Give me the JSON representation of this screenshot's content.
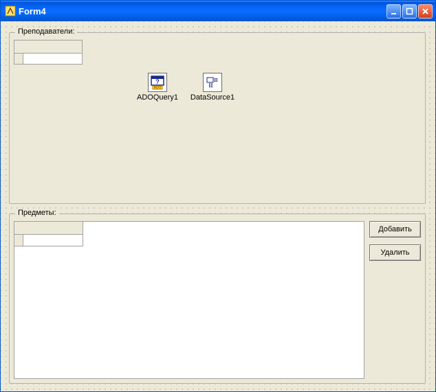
{
  "window": {
    "title": "Form4"
  },
  "groupboxes": {
    "top": {
      "legend": "Преподаватели:"
    },
    "bottom": {
      "legend": "Предметы:"
    }
  },
  "components": {
    "adoquery": {
      "label": "ADOQuery1"
    },
    "datasource": {
      "label": "DataSource1"
    }
  },
  "buttons": {
    "add": "Добавить",
    "delete": "Удалить"
  }
}
